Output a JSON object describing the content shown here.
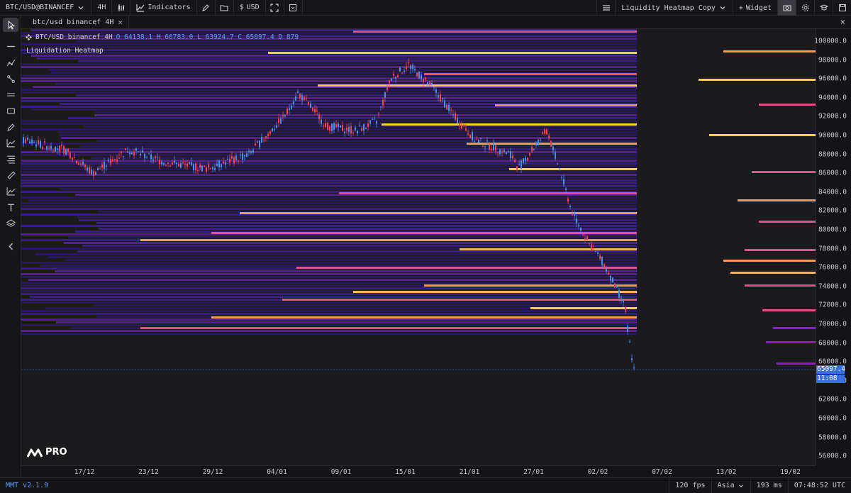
{
  "toolbar": {
    "symbol": "BTC/USD@BINANCEF",
    "interval": "4H",
    "indicators_label": "Indicators",
    "currency": "USD",
    "layout_name": "Liquidity Heatmap Copy",
    "widget_label": "Widget"
  },
  "tab": {
    "label": "btc/usd binancef 4H"
  },
  "legend": {
    "title": "BTC/USD binancef 4H",
    "ohlc": "O 64138.1  H 66783.0  L 63924.7  C 65097.4  D 879"
  },
  "indicator": {
    "label": "Liquidation Heatmap"
  },
  "logo": {
    "text": "PRO"
  },
  "price_axis": {
    "ticks": [
      "100000.0",
      "98000.0",
      "96000.0",
      "94000.0",
      "92000.0",
      "90000.0",
      "88000.0",
      "86000.0",
      "84000.0",
      "82000.0",
      "80000.0",
      "78000.0",
      "76000.0",
      "74000.0",
      "72000.0",
      "70000.0",
      "68000.0",
      "66000.0",
      "64000.0",
      "62000.0",
      "60000.0",
      "58000.0",
      "56000.0"
    ],
    "last_price": "65097.4",
    "countdown": "11:08"
  },
  "time_axis": {
    "ticks": [
      "17/12",
      "23/12",
      "29/12",
      "04/01",
      "09/01",
      "15/01",
      "21/01",
      "27/01",
      "02/02",
      "07/02",
      "13/02",
      "19/02"
    ]
  },
  "status": {
    "version": "MMT v2.1.9",
    "fps": "120 fps",
    "region": "Asia",
    "latency": "193 ms",
    "clock": "07:48:52 UTC"
  },
  "colors": {
    "background": "#1b1b1d",
    "heat_low": "#3a12a8",
    "heat_mid": "#8a1fc4",
    "heat_high": "#e0508a",
    "heat_peak": "#ffd23a",
    "candle_up": "#4a8dff",
    "candle_down": "#ff3a5c",
    "accent": "#3a6fe0"
  },
  "icons": [
    "cursor-icon",
    "line-icon",
    "trend-icon",
    "path-icon",
    "hline-icon",
    "rect-icon",
    "brush-icon",
    "chart-line-icon",
    "fib-icon",
    "ruler-icon",
    "area-icon",
    "text-icon",
    "layers-icon",
    "collapse-icon",
    "camera-icon",
    "settings-icon",
    "graduation-icon",
    "save-icon"
  ]
}
